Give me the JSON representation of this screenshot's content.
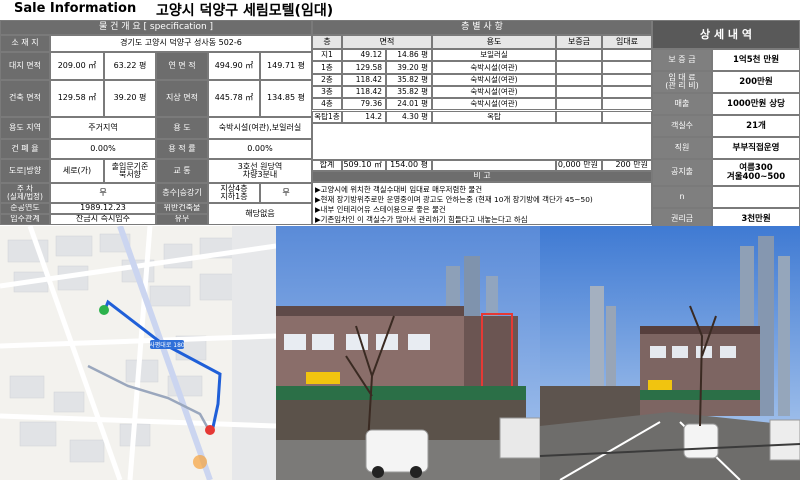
{
  "header": {
    "title": "Sale Information",
    "property_title": "고양시 덕양구 세림모텔(임대)"
  },
  "property": {
    "heading": "물 건 개 요 [ specification ]",
    "address_label": "소 재 지",
    "address": "경기도 고양시 덕양구 성사동 502-6",
    "land_area_label": "대지 면적",
    "land_area_m2": "209.00 ㎡",
    "land_area_py": "63.22 평",
    "total_floor_label": "연 면 적",
    "total_floor_m2": "494.90 ㎡",
    "total_floor_py": "149.71 평",
    "building_area_label": "건축 면적",
    "building_area_m2": "129.58 ㎡",
    "building_area_py": "39.20 평",
    "above_ground_label": "지상 면적",
    "above_ground_m2": "445.78 ㎡",
    "above_ground_py": "134.85 평",
    "zone_label": "용도 지역",
    "zone": "주거지역",
    "use_label": "용 도",
    "use": "숙박시설(여관),보일러실",
    "bcr_label": "건 폐 율",
    "bcr": "0.00%",
    "far_label": "용 적 률",
    "far": "0.00%",
    "road_label": "도로|방향",
    "road": "세로(가)",
    "direction": "출입문기준\n북서향",
    "transport_label": "교 통",
    "transport": "3호선 원당역\n차량3분내",
    "parking_label": "주 차\n(실제/법정)",
    "parking": "무",
    "floors_label": "층수|승강기",
    "floors": "지상4층\n지하1층",
    "elevator": "무",
    "completion_label": "준공연도",
    "completion": "1989.12.23",
    "violation_label": "위반건축물",
    "violation": "유무",
    "violation_value": "해당없음",
    "movein_label": "입주관계",
    "movein": "잔금시 즉시입주"
  },
  "floors_table": {
    "heading": "층 별 사 항",
    "headers": [
      "층",
      "면적",
      "",
      "용도",
      "보증금",
      "임대료"
    ],
    "rows": [
      [
        "지1",
        "49.12",
        "14.86 평",
        "보일러실",
        "",
        ""
      ],
      [
        "1층",
        "129.58",
        "39.20 평",
        "숙박시설(여관)",
        "",
        ""
      ],
      [
        "2층",
        "118.42",
        "35.82 평",
        "숙박시설(여관)",
        "",
        ""
      ],
      [
        "3층",
        "118.42",
        "35.82 평",
        "숙박시설(여관)",
        "",
        ""
      ],
      [
        "4층",
        "79.36",
        "24.01 평",
        "숙박시설(여관)",
        "",
        ""
      ],
      [
        "옥탑1층",
        "14.2",
        "4.30 평",
        "옥탑",
        "",
        ""
      ]
    ],
    "total_label": "합계",
    "total_m2": "509.10 ㎡",
    "total_py": "154.00 평",
    "total_deposit": "10,000 만원",
    "total_rent": "200 만원"
  },
  "remarks": {
    "heading": "비 고",
    "lines": [
      "▶고양시에 위치한 객실수대비 임대료 매우저렴한 물건",
      "▶현재 장기방위주로만 운영중이며 광고도 안하는중 (현재 10개 장기방에 객단가 45~50)",
      "▶내부 인테리어유 스테이용으로 좋은 물건",
      "▶기존임차인 이 객실수가 많아서 관리하기 힘들다고 내놓는다고 하심"
    ]
  },
  "details": {
    "heading": "상 세 내 역",
    "rows": [
      {
        "label": "보 증 금",
        "value": "1억5천 만원"
      },
      {
        "label": "임 대 료\n(관 리 비)",
        "value": "200만원"
      },
      {
        "label": "매출",
        "value": "1000만원 상당"
      },
      {
        "label": "객실수",
        "value": "21개"
      },
      {
        "label": "직원",
        "value": "부부직접운영"
      },
      {
        "label": "공지출",
        "value": "여름300\n겨울400~500"
      },
      {
        "label": "n",
        "value": ""
      },
      {
        "label": "권리금",
        "value": "3천만원"
      }
    ]
  },
  "map": {
    "road_label": "사평대로 180"
  },
  "colors": {
    "header_gray": "#6d6d6d",
    "route_blue": "#1f5fd8",
    "marker_red": "#e53935"
  }
}
